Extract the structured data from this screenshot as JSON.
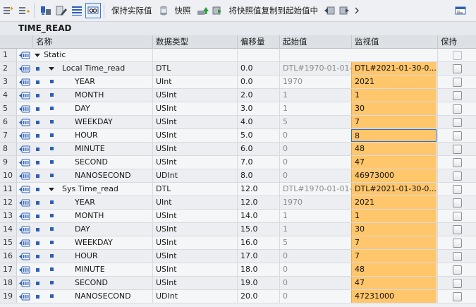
{
  "toolbar": {
    "keep_actual": "保持实际值",
    "snapshot": "快照",
    "copy_snapshot": "将快照值复制到起始值中"
  },
  "block": {
    "title": "TIME_READ"
  },
  "columns": {
    "name": "名称",
    "type": "数据类型",
    "offset": "偏移量",
    "start": "起始值",
    "monitor": "监视值",
    "retain": "保持"
  },
  "rows": [
    {
      "num": "1",
      "kind": "header",
      "name": "Static",
      "type": "",
      "offset": "",
      "start": "",
      "monitor": ""
    },
    {
      "num": "2",
      "kind": "struct",
      "name": "Local Time_read",
      "type": "DTL",
      "offset": "0.0",
      "start": "DTL#1970-01-01-0",
      "monitor": "DTL#2021-01-30-0..."
    },
    {
      "num": "3",
      "kind": "member",
      "name": "YEAR",
      "type": "UInt",
      "offset": "0.0",
      "start": "1970",
      "monitor": "2021"
    },
    {
      "num": "4",
      "kind": "member",
      "name": "MONTH",
      "type": "USInt",
      "offset": "2.0",
      "start": "1",
      "monitor": "1"
    },
    {
      "num": "5",
      "kind": "member",
      "name": "DAY",
      "type": "USInt",
      "offset": "3.0",
      "start": "1",
      "monitor": "30"
    },
    {
      "num": "6",
      "kind": "member",
      "name": "WEEKDAY",
      "type": "USInt",
      "offset": "4.0",
      "start": "5",
      "monitor": "7"
    },
    {
      "num": "7",
      "kind": "member",
      "name": "HOUR",
      "type": "USInt",
      "offset": "5.0",
      "start": "0",
      "monitor": "8",
      "selected": true
    },
    {
      "num": "8",
      "kind": "member",
      "name": "MINUTE",
      "type": "USInt",
      "offset": "6.0",
      "start": "0",
      "monitor": "48"
    },
    {
      "num": "9",
      "kind": "member",
      "name": "SECOND",
      "type": "USInt",
      "offset": "7.0",
      "start": "0",
      "monitor": "47"
    },
    {
      "num": "10",
      "kind": "member",
      "name": "NANOSECOND",
      "type": "UDInt",
      "offset": "8.0",
      "start": "0",
      "monitor": "46973000"
    },
    {
      "num": "11",
      "kind": "struct",
      "name": "Sys Time_read",
      "type": "DTL",
      "offset": "12.0",
      "start": "DTL#1970-01-01-0",
      "monitor": "DTL#2021-01-30-0..."
    },
    {
      "num": "12",
      "kind": "member",
      "name": "YEAR",
      "type": "UInt",
      "offset": "12.0",
      "start": "1970",
      "monitor": "2021"
    },
    {
      "num": "13",
      "kind": "member",
      "name": "MONTH",
      "type": "USInt",
      "offset": "14.0",
      "start": "1",
      "monitor": "1"
    },
    {
      "num": "14",
      "kind": "member",
      "name": "DAY",
      "type": "USInt",
      "offset": "15.0",
      "start": "1",
      "monitor": "30"
    },
    {
      "num": "15",
      "kind": "member",
      "name": "WEEKDAY",
      "type": "USInt",
      "offset": "16.0",
      "start": "5",
      "monitor": "7"
    },
    {
      "num": "16",
      "kind": "member",
      "name": "HOUR",
      "type": "USInt",
      "offset": "17.0",
      "start": "0",
      "monitor": "7"
    },
    {
      "num": "17",
      "kind": "member",
      "name": "MINUTE",
      "type": "USInt",
      "offset": "18.0",
      "start": "0",
      "monitor": "48"
    },
    {
      "num": "18",
      "kind": "member",
      "name": "SECOND",
      "type": "USInt",
      "offset": "19.0",
      "start": "0",
      "monitor": "47"
    },
    {
      "num": "19",
      "kind": "member",
      "name": "NANOSECOND",
      "type": "UDInt",
      "offset": "20.0",
      "start": "0",
      "monitor": "47231000"
    }
  ],
  "colors": {
    "monitor_bg": "#ffc66b",
    "accent": "#2c5fb8",
    "selection": "#2f6fd1"
  }
}
